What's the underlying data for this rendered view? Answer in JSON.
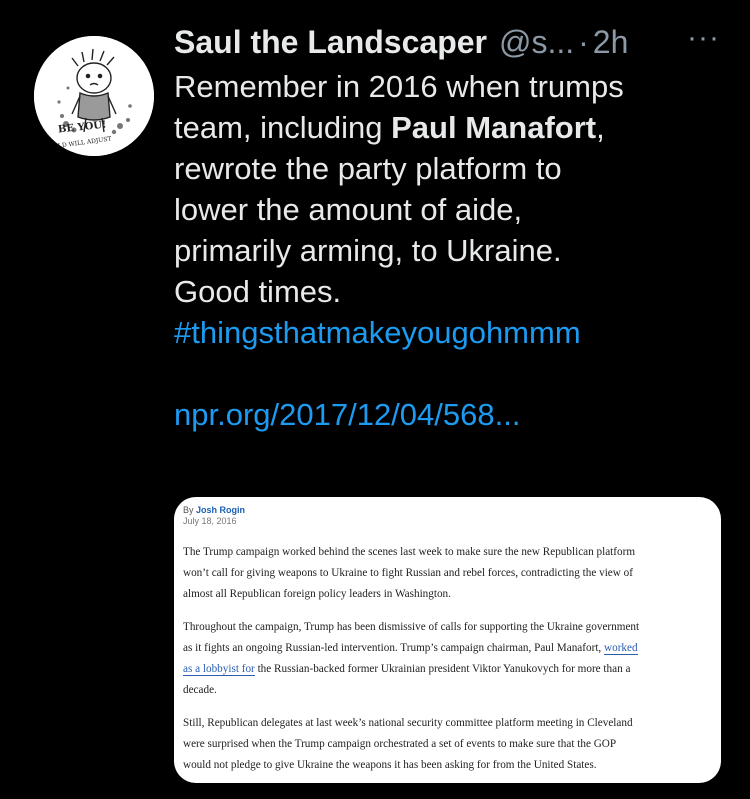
{
  "tweet": {
    "display_name": "Saul the Landscaper",
    "handle": "@s...",
    "separator": "·",
    "time": "2h",
    "more": "···",
    "avatar_caption_1": "BE YOU!",
    "avatar_caption_2": "WORLD WILL ADJUST",
    "text_line_1": "Remember in 2016 when trumps",
    "text_line_2_pre": "team, including ",
    "text_line_2_bold": "Paul Manafort",
    "text_line_2_post": ",",
    "text_line_3": "rewrote the party platform to",
    "text_line_4": "lower the amount of aide,",
    "text_line_5": "primarily arming, to Ukraine.",
    "text_line_6": "Good times.",
    "hashtag": "#thingsthatmakeyougohmmm",
    "url": "npr.org/2017/12/04/568..."
  },
  "card": {
    "by_prefix": "By ",
    "author": "Josh Rogin",
    "date": "July 18, 2016",
    "p1_l1": "The Trump campaign worked behind the scenes last week to make sure the new Republican platform",
    "p1_l2": "won’t call for giving weapons to Ukraine to fight Russian and rebel forces, contradicting the view of",
    "p1_l3": "almost all Republican foreign policy leaders in Washington.",
    "p2_l1": "Throughout the campaign, Trump has been dismissive of calls for supporting the Ukraine government",
    "p2_l2_pre": "as it fights an ongoing Russian-led intervention. Trump’s campaign chairman, Paul Manafort, ",
    "p2_l2_link": "worked",
    "p2_l3_link": "as a lobbyist for",
    "p2_l3_post": " the Russian-backed former Ukrainian president Viktor Yanukovych for more than a",
    "p2_l4": "decade.",
    "p3_l1": "Still, Republican delegates at last week’s national security committee platform meeting in Cleveland",
    "p3_l2": "were surprised when the Trump campaign orchestrated a set of events to make sure that the GOP",
    "p3_l3": "would not pledge to give Ukraine the weapons it has been asking for from the United States."
  },
  "colors": {
    "background": "#000000",
    "text": "#e7e9ea",
    "secondary": "#8b98a5",
    "link": "#1d9bf0"
  }
}
